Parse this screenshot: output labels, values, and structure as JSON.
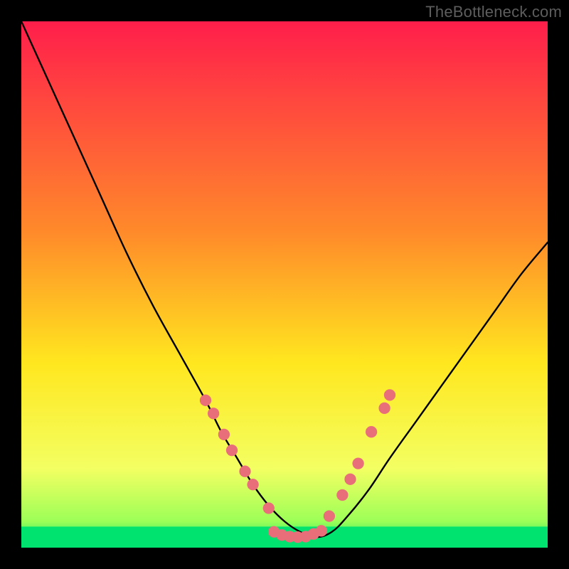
{
  "watermark": "TheBottleneck.com",
  "chart_data": {
    "type": "line",
    "title": "",
    "xlabel": "",
    "ylabel": "",
    "xlim": [
      0,
      100
    ],
    "ylim": [
      0,
      100
    ],
    "gradient_stops": [
      {
        "offset": 0,
        "color": "#ff1e4b"
      },
      {
        "offset": 40,
        "color": "#ff8a2a"
      },
      {
        "offset": 65,
        "color": "#ffe71f"
      },
      {
        "offset": 85,
        "color": "#f3ff62"
      },
      {
        "offset": 95,
        "color": "#9cff57"
      },
      {
        "offset": 100,
        "color": "#00e46f"
      }
    ],
    "curve": {
      "x": [
        0,
        5,
        10,
        15,
        20,
        25,
        30,
        35,
        38,
        41,
        44,
        47,
        50,
        53,
        56,
        59,
        62,
        66,
        70,
        75,
        80,
        85,
        90,
        95,
        100
      ],
      "y": [
        100,
        89,
        78,
        67,
        56,
        46,
        37,
        28,
        22,
        17,
        12,
        8,
        5,
        3,
        2,
        3,
        6,
        11,
        17,
        24,
        31,
        38,
        45,
        52,
        58
      ]
    },
    "bottom_band": {
      "color": "#00e46f",
      "from_y": 0,
      "to_y": 4
    },
    "markers": {
      "color": "#e86f7a",
      "radius_pct": 1.1,
      "points": [
        {
          "x": 35.0,
          "y": 28.0
        },
        {
          "x": 36.5,
          "y": 25.5
        },
        {
          "x": 38.5,
          "y": 21.5
        },
        {
          "x": 40.0,
          "y": 18.5
        },
        {
          "x": 42.5,
          "y": 14.5
        },
        {
          "x": 44.0,
          "y": 12.0
        },
        {
          "x": 47.0,
          "y": 7.5
        },
        {
          "x": 48.0,
          "y": 3.0
        },
        {
          "x": 49.5,
          "y": 2.4
        },
        {
          "x": 51.0,
          "y": 2.1
        },
        {
          "x": 52.5,
          "y": 2.0
        },
        {
          "x": 54.0,
          "y": 2.1
        },
        {
          "x": 55.5,
          "y": 2.6
        },
        {
          "x": 57.0,
          "y": 3.2
        },
        {
          "x": 58.5,
          "y": 6.0
        },
        {
          "x": 61.0,
          "y": 10.0
        },
        {
          "x": 62.5,
          "y": 13.0
        },
        {
          "x": 64.0,
          "y": 16.0
        },
        {
          "x": 66.5,
          "y": 22.0
        },
        {
          "x": 69.0,
          "y": 26.5
        },
        {
          "x": 70.0,
          "y": 29.0
        }
      ]
    }
  }
}
